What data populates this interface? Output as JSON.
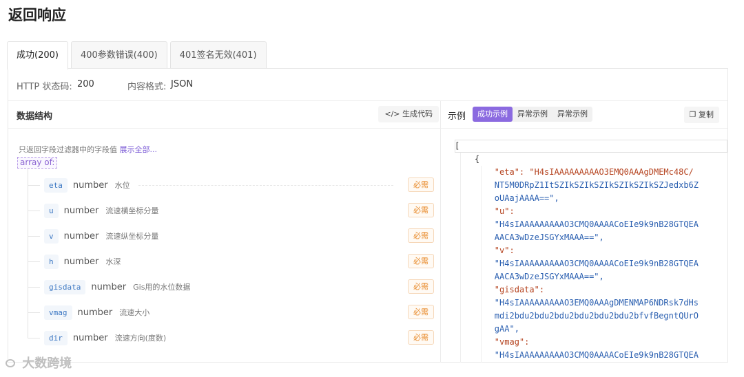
{
  "page": {
    "title": "返回响应"
  },
  "tabs": [
    {
      "label": "成功(200)",
      "active": true
    },
    {
      "label": "400参数错误(400)",
      "active": false
    },
    {
      "label": "401签名无效(401)",
      "active": false
    }
  ],
  "meta": {
    "status_label": "HTTP 状态码:",
    "status_value": "200",
    "format_label": "内容格式:",
    "format_value": "JSON"
  },
  "schema": {
    "title": "数据结构",
    "gen_code_label": "</>  生成代码",
    "note": "只返回字段过滤器中的字段值",
    "show_all": "展示全部...",
    "array_tag": "array of:",
    "fields": [
      {
        "name": "eta",
        "type": "number",
        "desc": "水位",
        "required": "必需"
      },
      {
        "name": "u",
        "type": "number",
        "desc": "流速横坐标分量",
        "required": "必需"
      },
      {
        "name": "v",
        "type": "number",
        "desc": "流速纵坐标分量",
        "required": "必需"
      },
      {
        "name": "h",
        "type": "number",
        "desc": "水深",
        "required": "必需"
      },
      {
        "name": "gisdata",
        "type": "number",
        "desc": "Gis用的水位数据",
        "required": "必需"
      },
      {
        "name": "vmag",
        "type": "number",
        "desc": "流速大小",
        "required": "必需"
      },
      {
        "name": "dir",
        "type": "number",
        "desc": "流速方向(度数)",
        "required": "必需"
      }
    ]
  },
  "example": {
    "title": "示例",
    "tabs": [
      {
        "label": "成功示例",
        "active": true
      },
      {
        "label": "异常示例",
        "active": false
      },
      {
        "label": "异常示例",
        "active": false
      }
    ],
    "copy_label": "复制",
    "lines": [
      {
        "text": "["
      },
      {
        "text": "    {"
      },
      {
        "text": "        \"eta\": \"H4sIAAAAAAAAAO3EMQ0AAAgDMEMc48C/"
      },
      {
        "text": "        NT5M0DRpZ1ItSZIkSZIkSZIkSZIkSZIkSZJedxb6Z"
      },
      {
        "text": "        oUAajAAAA==\","
      },
      {
        "text": "        \"u\":"
      },
      {
        "text": "        \"H4sIAAAAAAAAAO3CMQ0AAAACoEIe9k9nB28GTQEA"
      },
      {
        "text": "        AACA3wDzeJSGYxMAAA==\","
      },
      {
        "text": "        \"v\":"
      },
      {
        "text": "        \"H4sIAAAAAAAAAO3CMQ0AAAACoEIe9k9nB28GTQEA"
      },
      {
        "text": "        AACA3wDzeJSGYxMAAA==\","
      },
      {
        "text": "        \"gisdata\":"
      },
      {
        "text": "        \"H4sIAAAAAAAAAO3EMQ0AAAgDMENMAP6NDRsk7dHs"
      },
      {
        "text": "        mdi2bdu2bdu2bdu2bdu2bdu2bdu2bfvfBegntQUrO"
      },
      {
        "text": "        gAA\","
      },
      {
        "text": "        \"vmag\":"
      },
      {
        "text": "        \"H4sIAAAAAAAAAO3CMQ0AAAACoEIe9k9nB28GTQEA"
      }
    ]
  },
  "watermark": {
    "text": "大数跨境"
  }
}
